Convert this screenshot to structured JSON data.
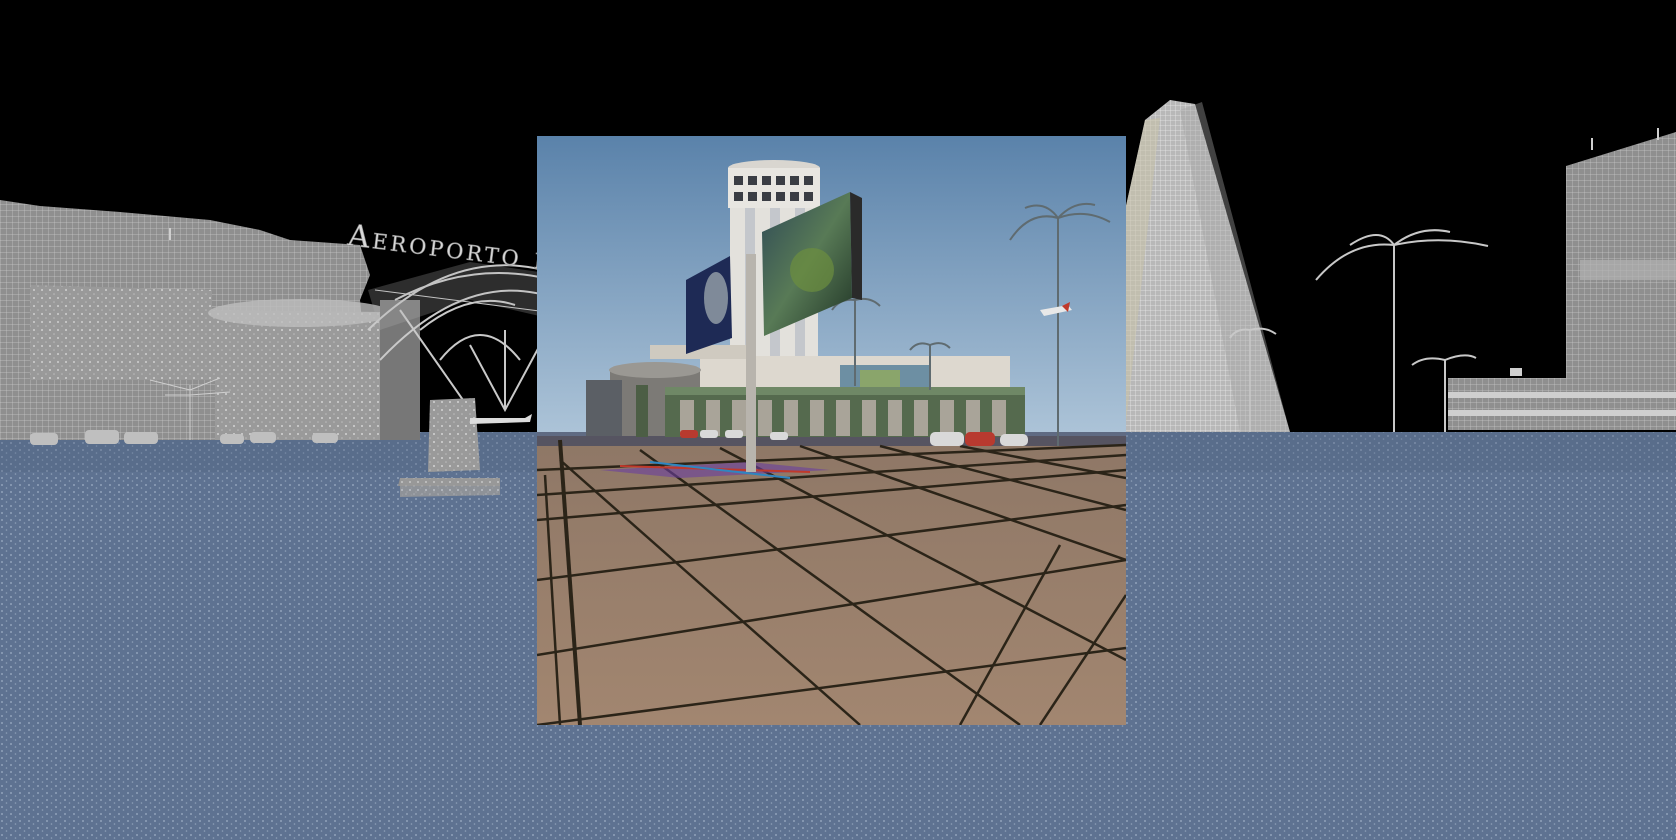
{
  "scene": {
    "sign": {
      "text": "Aeroporto di Siba"
    },
    "colors": {
      "sky_night": "#000000",
      "wire_ground": "#5f7390",
      "wire_ground_dots": "#9fb0c6",
      "wire_building": "#a7a7a7",
      "render_sky_top": "#5e86ad",
      "render_sky_bottom": "#a9c1d6",
      "render_floor": "#9c7e67",
      "render_grout": "#2b2418",
      "tower_white": "#e3e1dc",
      "arcade_green": "#4c5e45"
    },
    "objects": {
      "left_terminal": "wireframe-terminal-building",
      "canopy": "wireframe-arched-canopy",
      "monument": "wireframe-monument-block",
      "render_panel": "rendered-view-panel",
      "control_tower": "control-tower",
      "billboard": "billboard-on-pole",
      "arcade": "green-arcade-terminal",
      "right_tower": "tapered-skyscraper",
      "far_right_building": "wireframe-office-building",
      "palms": "palm-trees",
      "cars": "parked-cars",
      "airplanes": "airplanes"
    }
  }
}
